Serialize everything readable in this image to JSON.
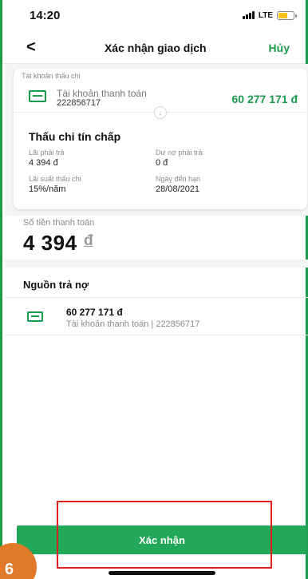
{
  "status_bar": {
    "time": "14:20",
    "network": "LTE"
  },
  "nav": {
    "back_label": "<",
    "title": "Xác nhận giao dịch",
    "cancel_label": "Hủy"
  },
  "overdraft_account": {
    "section_label": "Tài khoản thấu chi",
    "account_name": "Tài khoản thanh toán",
    "account_number": "222856717",
    "balance": "60 277 171 đ"
  },
  "overdraft_info": {
    "title": "Thấu chi tín chấp",
    "interest_due_label": "Lãi phải trả",
    "interest_due_value": "4 394 đ",
    "outstanding_label": "Dư nợ phải trả",
    "outstanding_value": "0 đ",
    "rate_label": "Lãi suất thấu chi",
    "rate_value": "15%/năm",
    "due_date_label": "Ngày đến hạn",
    "due_date_value": "28/08/2021"
  },
  "payment": {
    "label": "Số tiền thanh toán",
    "amount": "4 394",
    "currency": "đ"
  },
  "repayment_source": {
    "title": "Nguồn trả nợ",
    "amount": "60 277 171 đ",
    "detail": "Tài khoản thanh toán | 222856717"
  },
  "confirm": {
    "label": "Xác nhận"
  },
  "step_badge": "6",
  "colors": {
    "accent": "#1a9b4b",
    "button": "#21a858",
    "highlight": "#e02020",
    "badge": "#e07a2a"
  }
}
